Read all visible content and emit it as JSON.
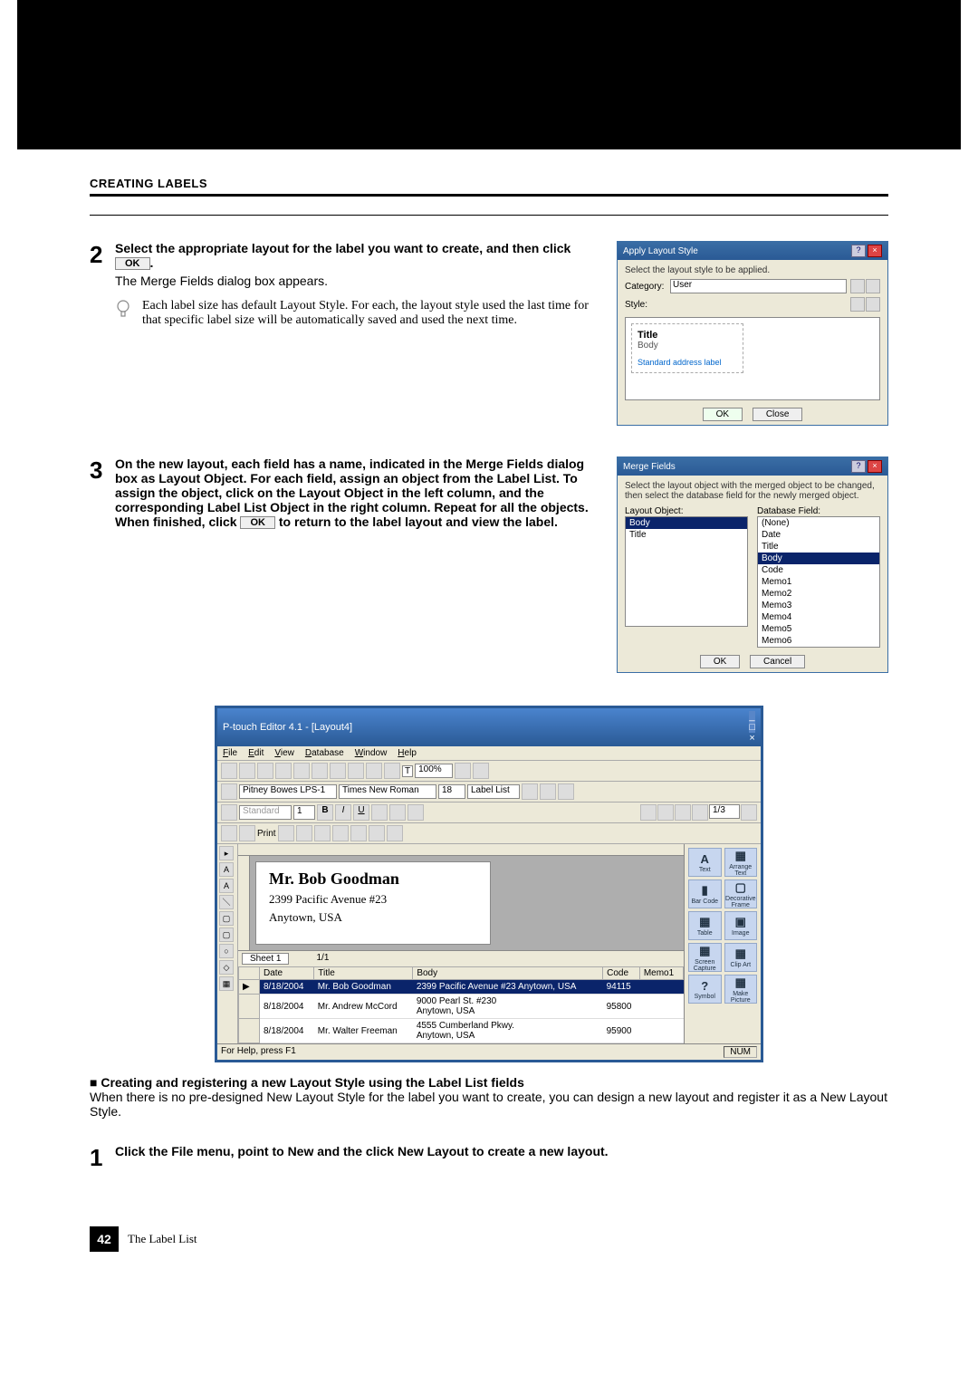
{
  "section_title": "CREATING LABELS",
  "step2": {
    "num": "2",
    "bold_line": "Select the appropriate layout for the label you want to create, and then click",
    "ok_button": "OK",
    "bold_end": ".",
    "plain_line": "The Merge Fields dialog box appears.",
    "tip": "Each label size has default Layout Style.  For each, the layout style used the last time for that specific label size will be automatically saved and used the next time."
  },
  "dlg_apply": {
    "title": "Apply Layout Style",
    "hint": "Select the layout style to be applied.",
    "category_label": "Category:",
    "category_val": "User",
    "style_label": "Style:",
    "preview_title": "Title",
    "preview_body": "Body",
    "preview_sub": "Standard address label",
    "ok": "OK",
    "close": "Close"
  },
  "step3": {
    "num": "3",
    "text": "On the new layout, each field has a name, indicated in the Merge Fields dialog box as Layout Object. For each field, assign an object from the Label List. To assign the object, click on the Layout Object in the left column, and the corresponding Label List Object in the right column. Repeat for all the objects. When finished, click",
    "ok_button": "OK",
    "text_end": "to return to the label layout and view the label."
  },
  "dlg_merge": {
    "title": "Merge Fields",
    "hint": "Select the layout object with the merged object to be changed, then select the database field for the newly merged object.",
    "layout_label": "Layout Object:",
    "db_label": "Database Field:",
    "layout_items": [
      "Body",
      "Title"
    ],
    "db_items": [
      "(None)",
      "Date",
      "Title",
      "Body",
      "Code",
      "Memo1",
      "Memo2",
      "Memo3",
      "Memo4",
      "Memo5",
      "Memo6"
    ],
    "ok": "OK",
    "cancel": "Cancel"
  },
  "editor": {
    "title": "P-touch Editor 4.1 - [Layout4]",
    "menu": [
      "File",
      "Edit",
      "View",
      "Database",
      "Window",
      "Help"
    ],
    "printer": "Pitney Bowes LPS-1",
    "font": "Times New Roman",
    "size": "18",
    "pager": "1/3",
    "print_label": "Print",
    "standard_label": "Standard",
    "label_name": "Mr. Bob Goodman",
    "label_addr1": "2399 Pacific Avenue #23",
    "label_addr2": "Anytown, USA",
    "sheet": "Sheet 1",
    "sheet_pager": "1/1",
    "label_list_btn": "Label List",
    "side_items": [
      {
        "icon": "A",
        "label": "Text"
      },
      {
        "icon": "▦",
        "label": "Arrange Text"
      },
      {
        "icon": "▮",
        "label": "Bar Code"
      },
      {
        "icon": "▢",
        "label": "Decorative Frame"
      },
      {
        "icon": "▦",
        "label": "Table"
      },
      {
        "icon": "▣",
        "label": "Image"
      },
      {
        "icon": "▦",
        "label": "Screen Capture"
      },
      {
        "icon": "▦",
        "label": "Clip Art"
      },
      {
        "icon": "?",
        "label": "Symbol"
      },
      {
        "icon": "▦",
        "label": "Make Picture"
      }
    ],
    "table_cols": [
      "Date",
      "Title",
      "Body",
      "Code",
      "Memo1"
    ],
    "table_rows": [
      {
        "date": "8/18/2004",
        "title": "Mr. Bob Goodman",
        "body": "2399 Pacific Avenue #23 Anytown, USA",
        "code": "94115",
        "memo": ""
      },
      {
        "date": "8/18/2004",
        "title": "Mr. Andrew McCord",
        "body": "9000 Pearl St. #230\nAnytown, USA",
        "code": "95800",
        "memo": ""
      },
      {
        "date": "8/18/2004",
        "title": "Mr. Walter Freeman",
        "body": "4555 Cumberland Pkwy.\nAnytown, USA",
        "code": "95900",
        "memo": ""
      }
    ],
    "status_left": "For Help, press F1",
    "status_right": "NUM"
  },
  "sub_head": "■ Creating and registering a new Layout Style using the Label List fields",
  "sub_para": "When there is no pre-designed New Layout Style for the label you want to create, you can design a new layout and register it as a New Layout Style.",
  "step1": {
    "num": "1",
    "text": "Click the File menu, point to New and the click New Layout to create a new layout."
  },
  "footer": {
    "page_num": "42",
    "text": "The Label List"
  }
}
